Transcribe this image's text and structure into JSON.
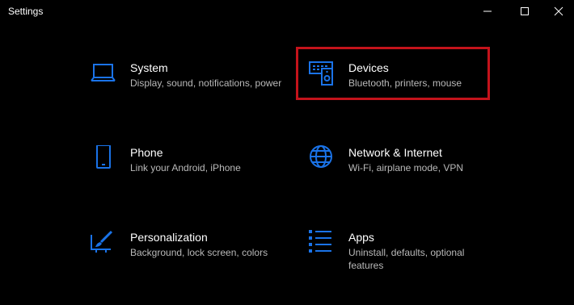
{
  "window": {
    "title": "Settings",
    "accent_color": "#1a73e8",
    "highlight_color": "#c4131b"
  },
  "titlebar_buttons": [
    {
      "name": "minimize",
      "icon": "minimize-icon"
    },
    {
      "name": "maximize",
      "icon": "maximize-icon"
    },
    {
      "name": "close",
      "icon": "close-icon"
    }
  ],
  "tiles": [
    {
      "id": "system",
      "label": "System",
      "description": "Display, sound, notifications, power",
      "icon": "laptop-icon"
    },
    {
      "id": "devices",
      "label": "Devices",
      "description": "Bluetooth, printers, mouse",
      "icon": "keyboard-speaker-icon",
      "highlighted": true
    },
    {
      "id": "phone",
      "label": "Phone",
      "description": "Link your Android, iPhone",
      "icon": "phone-icon"
    },
    {
      "id": "network",
      "label": "Network & Internet",
      "description": "Wi-Fi, airplane mode, VPN",
      "icon": "globe-icon"
    },
    {
      "id": "personalization",
      "label": "Personalization",
      "description": "Background, lock screen, colors",
      "icon": "paint-brush-icon"
    },
    {
      "id": "apps",
      "label": "Apps",
      "description": "Uninstall, defaults, optional features",
      "icon": "apps-list-icon"
    }
  ]
}
